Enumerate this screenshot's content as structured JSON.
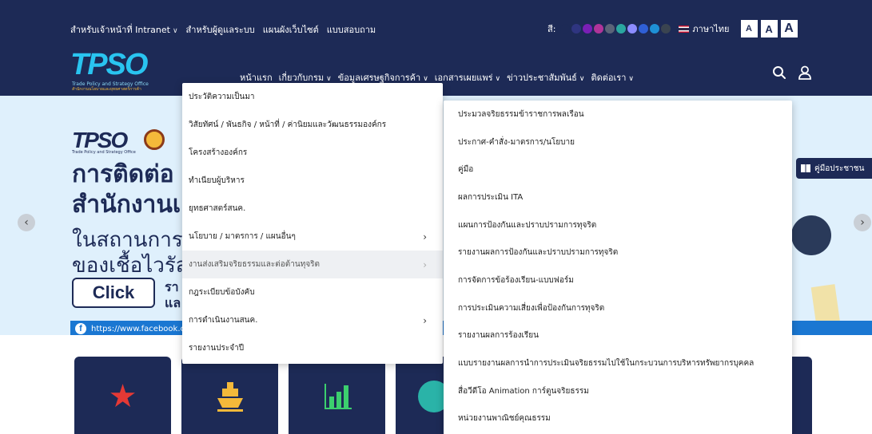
{
  "topbar": {
    "links": [
      {
        "label": "สำหรับเจ้าหน้าที่ Intranet",
        "has_dropdown": true
      },
      {
        "label": "สำหรับผู้ดูแลระบบ",
        "has_dropdown": false
      },
      {
        "label": "แผนผังเว็บไซต์",
        "has_dropdown": false
      },
      {
        "label": "แบบสอบถาม",
        "has_dropdown": false
      }
    ],
    "color_label": "สี:",
    "color_swatches": [
      "#1d2a56",
      "#2f3580",
      "#7a1fb5",
      "#b0349a",
      "#5b6478",
      "#2aa7a0",
      "#8c8cff",
      "#2f5fd6",
      "#1e90d6",
      "#3a4450"
    ],
    "language": "ภาษาไทย",
    "font_sizes": [
      "A",
      "A",
      "A"
    ]
  },
  "logo": {
    "text": "TPSO",
    "sub_en": "Trade Policy and Strategy Office",
    "sub_th": "สำนักงานนโยบายและยุทธศาสตร์การค้า"
  },
  "nav": {
    "items": [
      {
        "label": "หน้าแรก",
        "has_dropdown": false
      },
      {
        "label": "เกี่ยวกับกรม",
        "has_dropdown": true
      },
      {
        "label": "ข้อมูลเศรษฐกิจการค้า",
        "has_dropdown": true
      },
      {
        "label": "เอกสารเผยแพร่",
        "has_dropdown": true
      },
      {
        "label": "ข่าวประชาสัมพันธ์",
        "has_dropdown": true
      },
      {
        "label": "ติดต่อเรา",
        "has_dropdown": true
      }
    ]
  },
  "hero": {
    "logo": "TPSO",
    "logo_sub": "Trade Policy and Strategy Office",
    "heading_1": "การติดต่อ",
    "heading_2": "สำนักงานเ",
    "text_1": "ในสถานการณ์",
    "text_2": "ของเชื้อไวรัสโ",
    "click_label": "Click",
    "right_1": "รา",
    "right_2": "แล",
    "facebook_text": "https://www.facebook.c",
    "manual_label": "คู่มือประชาชน",
    "prev": "‹",
    "next": "›"
  },
  "menu_about": {
    "items": [
      {
        "label": "ประวัติความเป็นมา",
        "has_sub": false
      },
      {
        "label": "วิสัยทัศน์ / พันธกิจ / หน้าที่ / ค่านิยมและวัฒนธรรมองค์กร",
        "has_sub": false
      },
      {
        "label": "โครงสร้างองค์กร",
        "has_sub": false
      },
      {
        "label": "ทำเนียบผู้บริหาร",
        "has_sub": false
      },
      {
        "label": "ยุทธศาสตร์สนค.",
        "has_sub": false
      },
      {
        "label": "นโยบาย / มาตรการ / แผนอื่นๆ",
        "has_sub": true
      },
      {
        "label": "งานส่งเสริมจริยธรรมและต่อต้านทุจริต",
        "has_sub": true,
        "active": true
      },
      {
        "label": "กฎระเบียบข้อบังคับ",
        "has_sub": false
      },
      {
        "label": "การดำเนินงานสนค.",
        "has_sub": true
      },
      {
        "label": "รายงานประจำปี",
        "has_sub": false
      }
    ]
  },
  "menu_ethics": {
    "items": [
      "ประมวลจริยธรรมข้าราชการพลเรือน",
      "ประกาศ-คำสั่ง-มาตรการ/นโยบาย",
      "คู่มือ",
      "ผลการประเมิน ITA",
      "แผนการป้องกันและปราบปรามการทุจริต",
      "รายงานผลการป้องกันและปราบปรามการทุจริต",
      "การจัดการข้อร้องเรียน-แบบฟอร์ม",
      "การประเมินความเสี่ยงเพื่อป้องกันการทุจริต",
      "รายงานผลการร้องเรียน",
      "แบบรายงานผลการนำการประเมินจริยธรรมไปใช้ในกระบวนการบริหารทรัพยากรบุคคล",
      "สื่อวีดีโอ Animation การ์ตูนจริยธรรม",
      "หน่วยงานพาณิชย์คุณธรรม"
    ]
  },
  "colors": {
    "header_bg": "#1d2a56",
    "accent": "#29c4f0",
    "hero_bg": "#dff0fc",
    "active_item_bg": "#eef0f3"
  }
}
